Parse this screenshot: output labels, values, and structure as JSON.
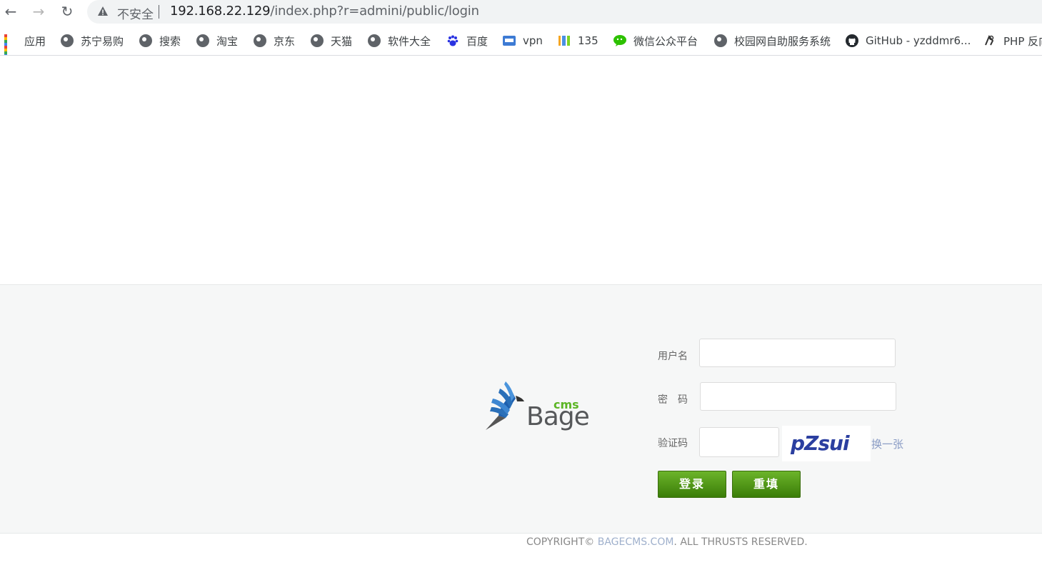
{
  "browser": {
    "security_label": "不安全",
    "url_host": "192.168.22.129",
    "url_path": "/index.php?r=admini/public/login"
  },
  "bookmarks": [
    {
      "label": "应用",
      "icon": "apps-grid-icon"
    },
    {
      "label": "苏宁易购",
      "icon": "globe-icon"
    },
    {
      "label": "搜索",
      "icon": "globe-icon"
    },
    {
      "label": "淘宝",
      "icon": "globe-icon"
    },
    {
      "label": "京东",
      "icon": "globe-icon"
    },
    {
      "label": "天猫",
      "icon": "globe-icon"
    },
    {
      "label": "软件大全",
      "icon": "globe-icon"
    },
    {
      "label": "百度",
      "icon": "baidu-paw-icon"
    },
    {
      "label": "vpn",
      "icon": "vpn-icon"
    },
    {
      "label": "135",
      "icon": "135-icon"
    },
    {
      "label": "微信公众平台",
      "icon": "wechat-icon"
    },
    {
      "label": "校园网自助服务系统",
      "icon": "globe-icon"
    },
    {
      "label": "GitHub - yzddmr6...",
      "icon": "github-icon"
    },
    {
      "label": "PHP 反向",
      "icon": "php-icon"
    }
  ],
  "login": {
    "logo_bage": "Bage",
    "logo_cms": "cms",
    "username_label": "用户名",
    "password_label": "密　码",
    "captcha_label": "验证码",
    "captcha_text": "pZsui",
    "refresh_label": "换一张",
    "submit_label": "登录",
    "reset_label": "重填"
  },
  "footer": {
    "prefix": "COPYRIGHT© ",
    "brand": "BAGECMS.COM",
    "suffix": ". ALL THRUSTS RESERVED."
  },
  "colors": {
    "button_green": "#4e9a14",
    "logo_blue": "#2a6fb8",
    "logo_green": "#5bb524",
    "band_bg": "#f6f7f7"
  }
}
